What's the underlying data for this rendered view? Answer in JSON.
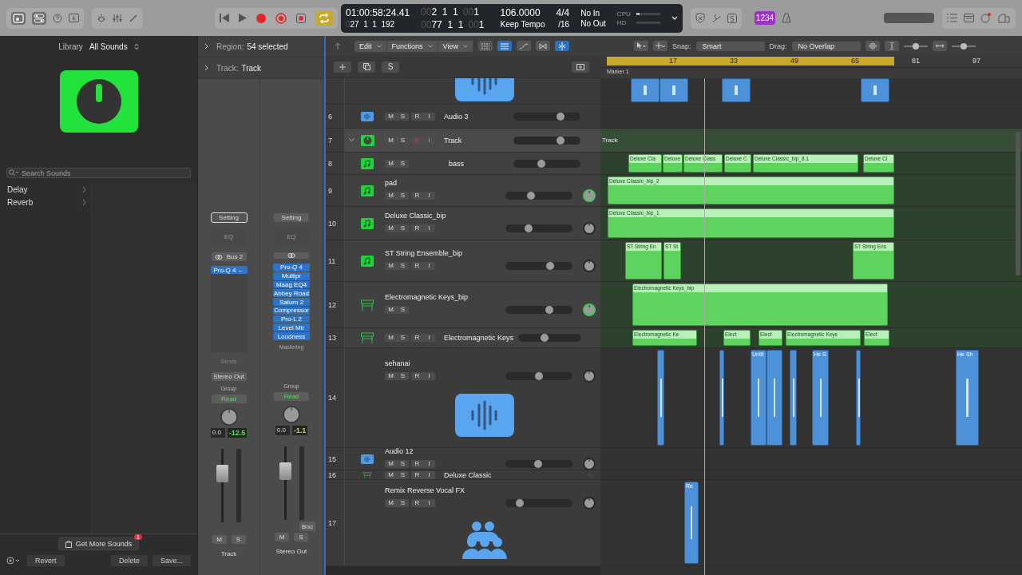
{
  "transport": {
    "cycle": true
  },
  "lcd": {
    "time": "01:00:58:24.41",
    "sub_dim": "0",
    "sub_time": "27  1  1  192",
    "position": [
      {
        "dim": "00",
        "text": "2  1  1"
      },
      {
        "dim": "00",
        "text": "1"
      }
    ],
    "end": [
      {
        "dim": "00",
        "text": "77  1  1"
      },
      {
        "dim": "00",
        "text": "1"
      }
    ],
    "tempo": "106.0000",
    "tempo_mode": "Keep Tempo",
    "signature": "4/4",
    "division": "/16",
    "input": "No In",
    "output": "No Out",
    "cpu": {
      "label": "CPU",
      "level": 0.15
    },
    "hd": {
      "label": "HD",
      "level": 0
    }
  },
  "count_in": {
    "label": "1234",
    "on": true
  },
  "library": {
    "title": "Library",
    "filter": "All Sounds",
    "search_placeholder": "Search Sounds",
    "items": [
      {
        "label": "Delay",
        "selected": false
      },
      {
        "label": "Reverb",
        "selected": false
      }
    ],
    "get_more": "Get More Sounds",
    "get_more_badge": "1",
    "buttons": [
      "Revert",
      "Delete",
      "Save..."
    ]
  },
  "inspector": {
    "region_label": "Region:",
    "region_value": "54 selected",
    "track_label": "Track:",
    "track_value": "Track"
  },
  "channel_strips": [
    {
      "setting": "Setting",
      "setting_selected": true,
      "eq": "EQ",
      "link": "Bus 2",
      "plugins": [
        "Pro-Q 4 ←"
      ],
      "sends": "Sends",
      "output": "Stereo Out",
      "group": "Group",
      "automation": "Read",
      "volume": "0.0",
      "peak": "-12.5",
      "level": 0.72,
      "mute": "M",
      "solo": "S",
      "name": "Track"
    },
    {
      "setting": "Setting",
      "setting_selected": false,
      "eq": "EQ",
      "plugins": [
        "Pro-Q 4",
        "Multipr",
        "Maag EQ4",
        "Abbey Road",
        "Saturn 2",
        "Compressor",
        "Pro-L 2",
        "Level Mtr",
        "Loudness"
      ],
      "plugin_group": "Mastering",
      "group": "Group",
      "automation": "Read",
      "volume": "0.0",
      "peak": "-1.1",
      "level": 0.72,
      "bounce": "Bnc",
      "mute": "M",
      "solo": "S",
      "name": "Stereo Out"
    }
  ],
  "tracks_toolbar": {
    "menus": [
      "Edit",
      "Functions",
      "View"
    ],
    "solo_button": "S",
    "snap_label": "Snap:",
    "snap": "Smart",
    "drag_label": "Drag:",
    "drag": "No Overlap",
    "waveform_zoom": {
      "level": 0.5
    },
    "horizontal_zoom": {
      "level": 0.5
    }
  },
  "ruler": {
    "bars": [
      "17",
      "33",
      "49",
      "65",
      "81",
      "97"
    ],
    "marker": "Marker 1"
  },
  "tracks": [
    {
      "regions": [
        {
          "kind": "audio"
        },
        {
          "kind": "audio"
        },
        {
          "kind": "audio"
        },
        {
          "kind": "audio"
        }
      ]
    },
    {
      "number": "6",
      "name": "Audio 3",
      "buttons": [
        "M",
        "S",
        "R",
        "I"
      ],
      "armed": false,
      "selected": false,
      "level": 0.7
    },
    {
      "number": "7",
      "name": "Track",
      "buttons": [
        "M",
        "S",
        "R",
        "I"
      ],
      "armed": true,
      "selected": true,
      "expanded": true,
      "level": 0.7,
      "regions": [
        {
          "kind": "folder",
          "label": "Track"
        }
      ],
      "children": [
        {
          "number": "8",
          "name": "bass",
          "buttons": [
            "M",
            "S"
          ],
          "selected": false,
          "level": 0.42,
          "regions": [
            {
              "kind": "midi",
              "label": "Deluxe Cla"
            },
            {
              "kind": "midi",
              "label": "Deluxe"
            },
            {
              "kind": "midi",
              "label": "Deluxe Class"
            },
            {
              "kind": "midi",
              "label": "Deluxe C"
            },
            {
              "kind": "midi",
              "label": "Deluxe Classic_bip_8.1"
            },
            {
              "kind": "midi",
              "label": "Deluxe Cl"
            }
          ]
        },
        {
          "number": "9",
          "name": "pad",
          "buttons": [
            "M",
            "S",
            "R",
            "I"
          ],
          "armed": false,
          "selected": false,
          "level": 0.38,
          "regions": [
            {
              "kind": "midi",
              "label": "Deluxe Classic_bip_2"
            }
          ]
        },
        {
          "number": "10",
          "name": "Deluxe Classic_bip",
          "buttons": [
            "M",
            "S",
            "R",
            "I"
          ],
          "armed": false,
          "selected": false,
          "level": 0.35,
          "regions": [
            {
              "kind": "midi",
              "label": "Deluxe Classic_bip_1"
            }
          ]
        },
        {
          "number": "11",
          "name": "ST String Ensemble_bip",
          "buttons": [
            "M",
            "S",
            "R",
            "I"
          ],
          "armed": false,
          "selected": false,
          "level": 0.67,
          "regions": [
            {
              "kind": "midi",
              "label": "ST String En"
            },
            {
              "kind": "midi",
              "label": "ST St"
            },
            {
              "kind": "midi",
              "label": "ST String Ens"
            }
          ]
        },
        {
          "number": "12",
          "name": "Electromagnetic Keys_bip",
          "buttons": [
            "M",
            "S"
          ],
          "selected": false,
          "level": 0.65,
          "regions": [
            {
              "kind": "midi",
              "label": "Electromagnetic Keys_bip"
            }
          ]
        },
        {
          "number": "13",
          "name": "Electromagnetic Keys",
          "buttons": [
            "M",
            "S",
            "R",
            "I"
          ],
          "armed": false,
          "selected": false,
          "level": 0.42,
          "regions": [
            {
              "kind": "midi",
              "label": "Electromagnetic Ke"
            },
            {
              "kind": "midi",
              "label": "Elect"
            },
            {
              "kind": "midi",
              "label": "Elect"
            },
            {
              "kind": "midi",
              "label": "Electromagnetic Keys"
            },
            {
              "kind": "midi",
              "label": "Elect"
            }
          ]
        }
      ]
    },
    {
      "number": "14",
      "name": "sehanai",
      "buttons": [
        "M",
        "S",
        "R",
        "I"
      ],
      "armed": false,
      "selected": false,
      "level": 0.5,
      "regions": [
        {
          "kind": "audio"
        },
        {
          "kind": "audio"
        },
        {
          "kind": "audio",
          "label": "Untit"
        },
        {
          "kind": "audio"
        },
        {
          "kind": "audio"
        },
        {
          "kind": "audio",
          "label": "He S"
        },
        {
          "kind": "audio"
        },
        {
          "kind": "audio",
          "label": "He Sh"
        }
      ]
    },
    {
      "number": "15",
      "name": "Audio 12",
      "buttons": [
        "M",
        "S",
        "R",
        "I"
      ],
      "armed": false,
      "selected": false,
      "level": 0.49
    },
    {
      "number": "16",
      "name": "Deluxe Classic",
      "buttons": [
        "M",
        "S",
        "R",
        "I"
      ],
      "armed": false,
      "selected": false
    },
    {
      "number": "17",
      "name": "Remix Reverse Vocal FX",
      "buttons": [
        "M",
        "S",
        "R",
        "I"
      ],
      "armed": false,
      "selected": false,
      "level": 0.22,
      "regions": [
        {
          "kind": "audio",
          "label": "Re"
        }
      ]
    }
  ]
}
